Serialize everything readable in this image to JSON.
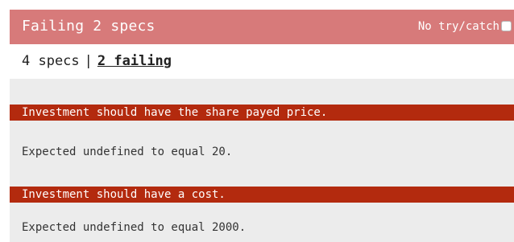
{
  "header": {
    "title": "Failing 2 specs",
    "try_catch_label": "No try/catch",
    "try_catch_checked": false,
    "background": "#d77a7a"
  },
  "summary": {
    "specs_count": "4 specs",
    "separator": "|",
    "failing_link": "2 failing"
  },
  "failures": [
    {
      "title": "Investment should have the share payed price.",
      "message": "Expected undefined to equal 20."
    },
    {
      "title": "Investment should have a cost.",
      "message": "Expected undefined to equal 2000."
    }
  ],
  "colors": {
    "failure_bar": "#b32a0e",
    "panel_background": "#ececec"
  }
}
